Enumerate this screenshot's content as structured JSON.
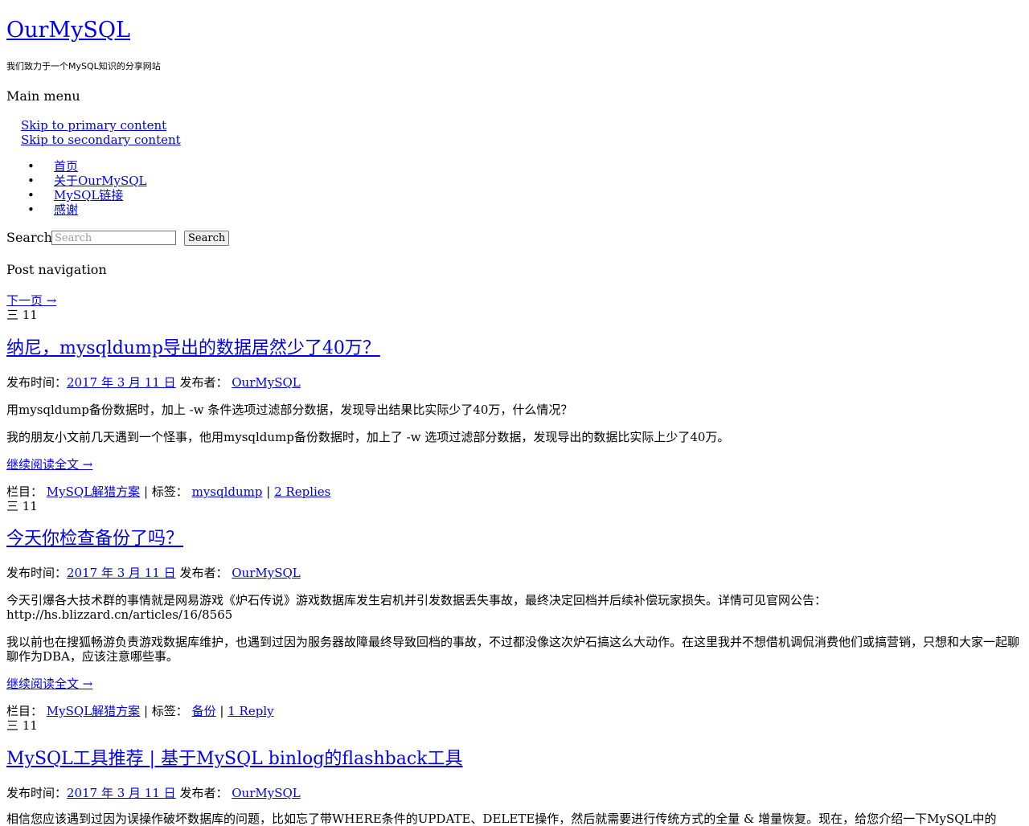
{
  "site": {
    "title": "OurMySQL",
    "description": "我们致力于一个MySQL知识的分享网站"
  },
  "nav": {
    "main_menu_label": "Main menu",
    "skip_primary": "Skip to primary content",
    "skip_secondary": "Skip to secondary content",
    "menu_items": [
      {
        "label": "首页"
      },
      {
        "label": "关于OurMySQL"
      },
      {
        "label": "MySQL链接"
      },
      {
        "label": "感谢"
      }
    ],
    "bullet": "•"
  },
  "search": {
    "label": "Search",
    "placeholder": "Search",
    "button_label": "Search"
  },
  "post_navigation": {
    "heading": "Post navigation",
    "next_link": "下一页 →"
  },
  "labels": {
    "published": "发布时间：",
    "author": "发布者：",
    "category": "栏目：",
    "tags": "标签：",
    "read_more": "继续阅读全文 →",
    "pipe": "|"
  },
  "posts": [
    {
      "date_badge": "三 11",
      "title": "纳尼，mysqldump导出的数据居然少了40万？",
      "date": "2017 年 3 月 11 日",
      "author": "OurMySQL",
      "paragraphs": [
        "用mysqldump备份数据时，加上 -w 条件选项过滤部分数据，发现导出结果比实际少了40万，什么情况？",
        "我的朋友小文前几天遇到一个怪事，他用mysqldump备份数据时，加上了 -w 选项过滤部分数据，发现导出的数据比实际上少了40万。"
      ],
      "category": "MySQL解猎方案",
      "tag": "mysqldump",
      "replies": "2 Replies"
    },
    {
      "date_badge": "三 11",
      "title": "今天你检查备份了吗？",
      "date": "2017 年 3 月 11 日",
      "author": "OurMySQL",
      "paragraphs": [
        "今天引爆各大技术群的事情就是网易游戏《炉石传说》游戏数据库发生宕机并引发数据丢失事故，最终决定回档并后续补偿玩家损失。详情可见官网公告：http://hs.blizzard.cn/articles/16/8565",
        "我以前也在搜狐畅游负责游戏数据库维护，也遇到过因为服务器故障最终导致回档的事故，不过都没像这次炉石搞这么大动作。在这里我并不想借机调侃消费他们或搞营销，只想和大家一起聊聊作为DBA，应该注意哪些事。"
      ],
      "category": "MySQL解猎方案",
      "tag": "备份",
      "replies": "1 Reply"
    },
    {
      "date_badge": "三 11",
      "title": "MySQL工具推荐 | 基于MySQL binlog的flashback工具",
      "date": "2017 年 3 月 11 日",
      "author": "OurMySQL",
      "paragraphs": [
        "相信您应该遇到过因为误操作破坏数据库的问题，比如忘了带WHERE条件的UPDATE、DELETE操作，然后就需要进行传统方式的全量 & 增量恢复。现在，给您介绍一下MySQL中的"
      ]
    }
  ]
}
